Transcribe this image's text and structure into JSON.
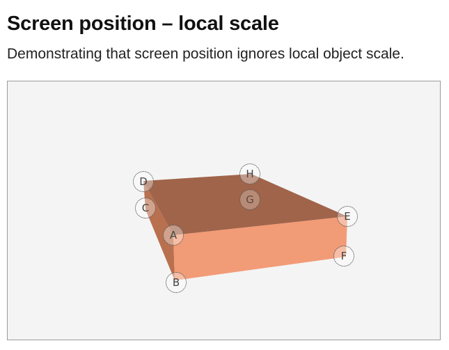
{
  "page": {
    "title": "Screen position – local scale",
    "subtitle": "Demonstrating that screen position ignores local object scale."
  },
  "scene": {
    "object_color": "#f29b77",
    "top_face_color": "#a0644a",
    "front_face_color": "#f29b77",
    "left_face_color": "#b9704f",
    "background_color": "#f4f4f4"
  },
  "markers": [
    {
      "id": "A",
      "label": "A"
    },
    {
      "id": "B",
      "label": "B"
    },
    {
      "id": "C",
      "label": "C"
    },
    {
      "id": "D",
      "label": "D"
    },
    {
      "id": "E",
      "label": "E"
    },
    {
      "id": "F",
      "label": "F"
    },
    {
      "id": "G",
      "label": "G"
    },
    {
      "id": "H",
      "label": "H"
    }
  ]
}
